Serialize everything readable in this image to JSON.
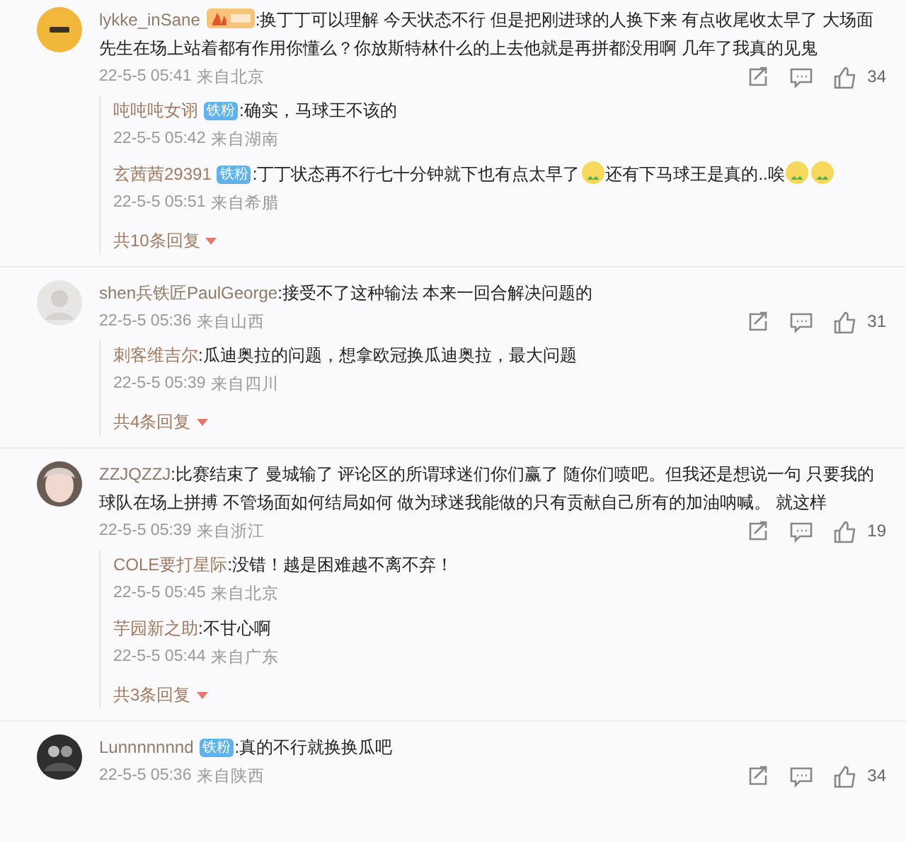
{
  "comments": [
    {
      "author": "lykke_inSane",
      "badge": {
        "kind": "gold"
      },
      "text": ":换丁丁可以理解 今天状态不行 但是把刚进球的人换下来 有点收尾收太早了 大场面先生在场上站着都有作用你懂么？你放斯特林什么的上去他就是再拼都没用啊 几年了我真的见鬼",
      "time": "22-5-5 05:41",
      "location": "来自北京",
      "likes": "34",
      "replies": [
        {
          "author": "吨吨吨女诩",
          "badge": {
            "kind": "fan",
            "label": "铁粉"
          },
          "parts": [
            {
              "kind": "text",
              "text": ":确实，马球王不该的"
            }
          ],
          "time": "22-5-5 05:42",
          "location": "来自湖南"
        },
        {
          "author": "玄茜茜29391",
          "badge": {
            "kind": "fan",
            "label": "铁粉"
          },
          "parts": [
            {
              "kind": "text",
              "text": ":丁丁状态再不行七十分钟就下也有点太早了"
            },
            {
              "kind": "emoji"
            },
            {
              "kind": "text",
              "text": "还有下马球王是真的..唉"
            },
            {
              "kind": "emoji"
            },
            {
              "kind": "emoji"
            }
          ],
          "time": "22-5-5 05:51",
          "location": "来自希腊"
        }
      ],
      "more": "共10条回复"
    },
    {
      "author": "shen兵铁匠PaulGeorge",
      "text": ":接受不了这种输法 本来一回合解决问题的",
      "time": "22-5-5 05:36",
      "location": "来自山西",
      "likes": "31",
      "replies": [
        {
          "author": "刺客维吉尔",
          "parts": [
            {
              "kind": "text",
              "text": ":瓜迪奥拉的问题，想拿欧冠换瓜迪奥拉，最大问题"
            }
          ],
          "time": "22-5-5 05:39",
          "location": "来自四川"
        }
      ],
      "more": "共4条回复"
    },
    {
      "author": "ZZJQZZJ",
      "text": ":比赛结束了 曼城输了 评论区的所谓球迷们你们赢了 随你们喷吧。但我还是想说一句 只要我的球队在场上拼搏 不管场面如何结局如何 做为球迷我能做的只有贡献自己所有的加油呐喊。 就这样",
      "time": "22-5-5 05:39",
      "location": "来自浙江",
      "likes": "19",
      "replies": [
        {
          "author": "COLE要打星际",
          "parts": [
            {
              "kind": "text",
              "text": ":没错！越是困难越不离不弃！"
            }
          ],
          "time": "22-5-5 05:45",
          "location": "来自北京"
        },
        {
          "author": "芋园新之助",
          "parts": [
            {
              "kind": "text",
              "text": ":不甘心啊"
            }
          ],
          "time": "22-5-5 05:44",
          "location": "来自广东"
        }
      ],
      "more": "共3条回复"
    },
    {
      "author": "Lunnnnnnnd",
      "badge": {
        "kind": "fan",
        "label": "铁粉"
      },
      "text": ":真的不行就换换瓜吧",
      "time": "22-5-5 05:36",
      "location": "来自陕西",
      "likes": "34"
    }
  ]
}
